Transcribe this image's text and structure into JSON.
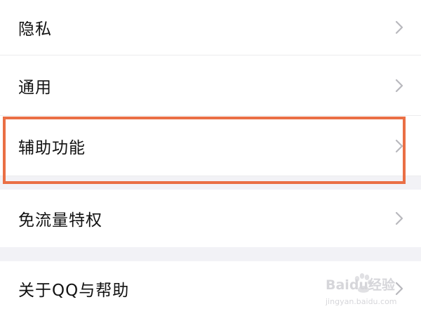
{
  "settings": {
    "items": [
      {
        "label": "隐私"
      },
      {
        "label": "通用"
      },
      {
        "label": "辅助功能"
      },
      {
        "label": "免流量特权"
      },
      {
        "label": "关于QQ与帮助"
      }
    ]
  },
  "watermark": {
    "brand": "Baidu经验",
    "url": "jingyan.baidu.com"
  },
  "colors": {
    "highlight": "#ea6f45",
    "background": "#f2f2f6",
    "row": "#ffffff",
    "chevron": "#b8b8bd"
  }
}
